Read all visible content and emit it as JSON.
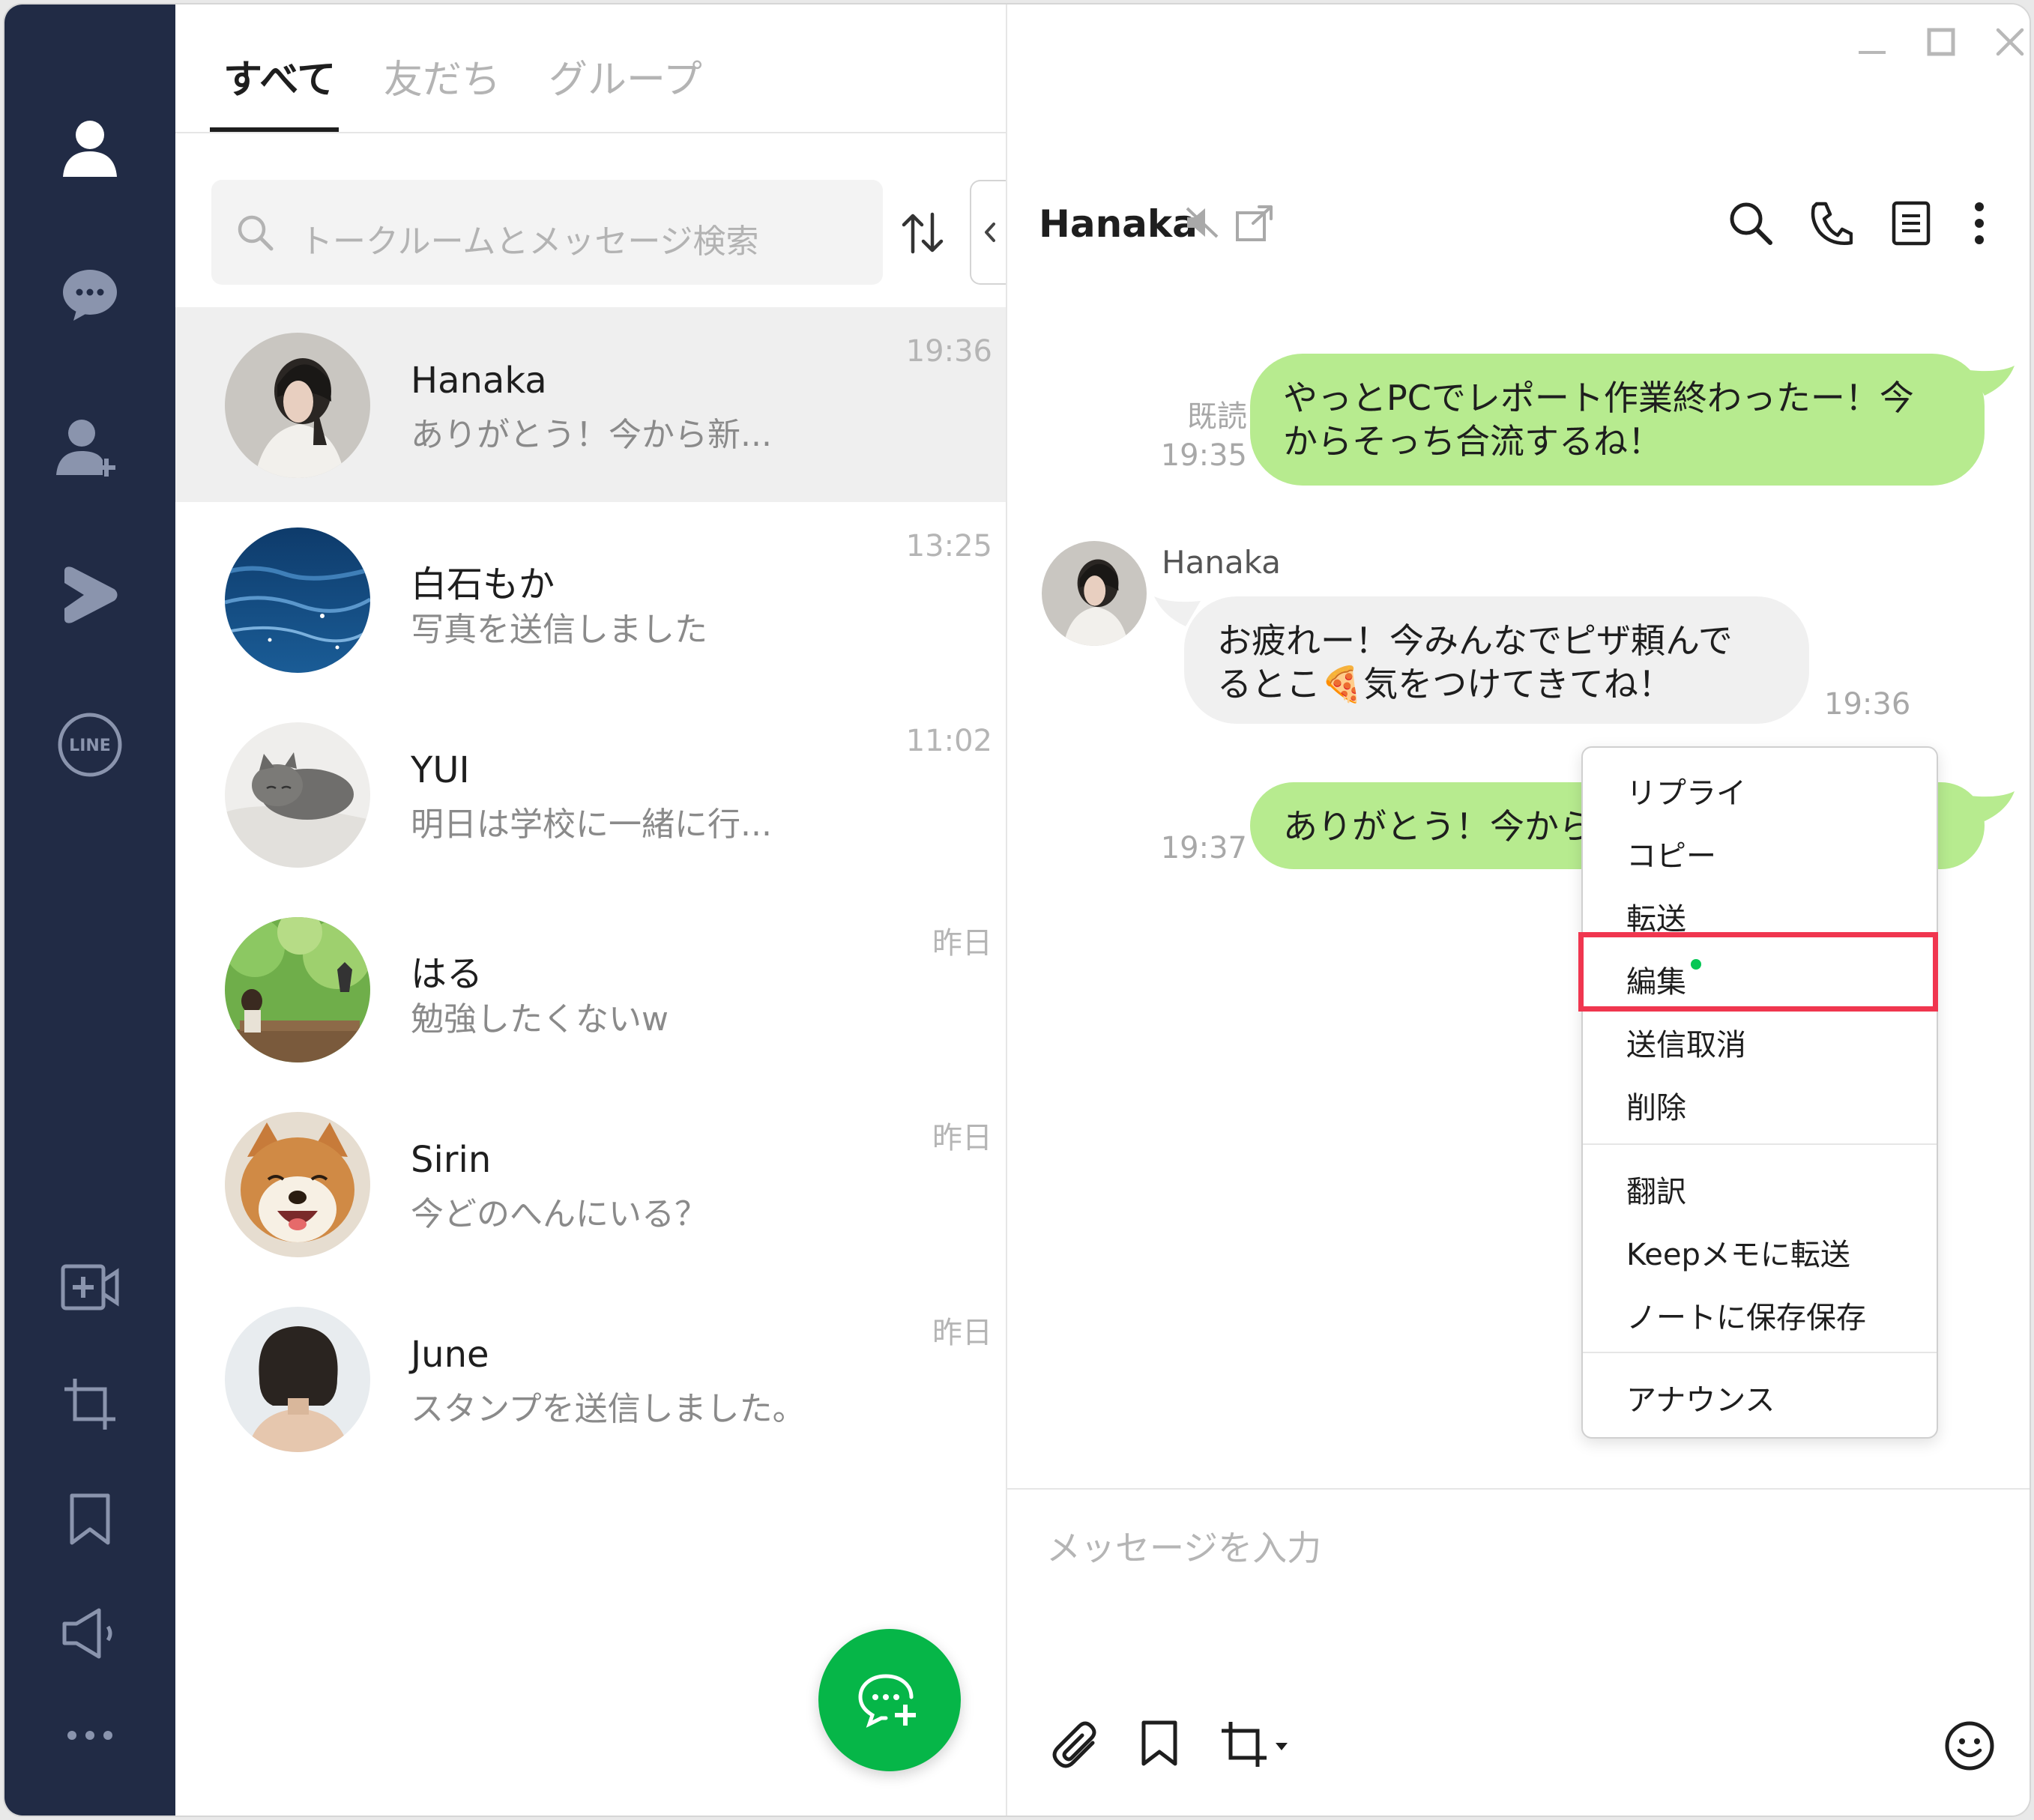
{
  "tabs": [
    {
      "label": "すべて",
      "active": true
    },
    {
      "label": "友だち",
      "active": false
    },
    {
      "label": "グループ",
      "active": false
    }
  ],
  "search": {
    "placeholder": "トークルームとメッセージ検索"
  },
  "chats": [
    {
      "name": "Hanaka",
      "preview": "ありがとう！今から新...",
      "time": "19:36",
      "active": true
    },
    {
      "name": "白石もか",
      "preview": "写真を送信しました",
      "time": "13:25"
    },
    {
      "name": "YUI",
      "preview": "明日は学校に一緒に行...",
      "time": "11:02"
    },
    {
      "name": "はる",
      "preview": "勉強したくないw",
      "time": "昨日"
    },
    {
      "name": "Sirin",
      "preview": "今どのへんにいる？",
      "time": "昨日"
    },
    {
      "name": "June",
      "preview": "スタンプを送信しました。",
      "time": "昨日"
    }
  ],
  "conversation": {
    "title": "Hanaka",
    "messages": [
      {
        "from": "me",
        "line1": "やっとPCでレポート作業終わったー！今",
        "line2": "からそっち合流するね！",
        "read": "既読",
        "time": "19:35"
      },
      {
        "from": "Hanaka",
        "sender": "Hanaka",
        "line1": "お疲れー！今みんなでピザ頼んで",
        "line2a": "るとこ",
        "emoji": "🍕",
        "line2b": "気をつけてきてね！",
        "time": "19:36"
      },
      {
        "from": "me",
        "line1": "ありがとう！今から",
        "time": "19:37"
      }
    ],
    "input_placeholder": "メッセージを入力"
  },
  "context_menu": {
    "items": [
      "リプライ",
      "コピー",
      "転送",
      "編集",
      "送信取消",
      "削除",
      "翻訳",
      "Keepメモに転送",
      "ノートに保存保存",
      "アナウンス"
    ],
    "highlighted": "編集"
  },
  "colors": {
    "sidebar": "#212b45",
    "accent_green": "#06b648",
    "my_bubble": "#b7eb8f",
    "highlight": "#f0364f"
  }
}
